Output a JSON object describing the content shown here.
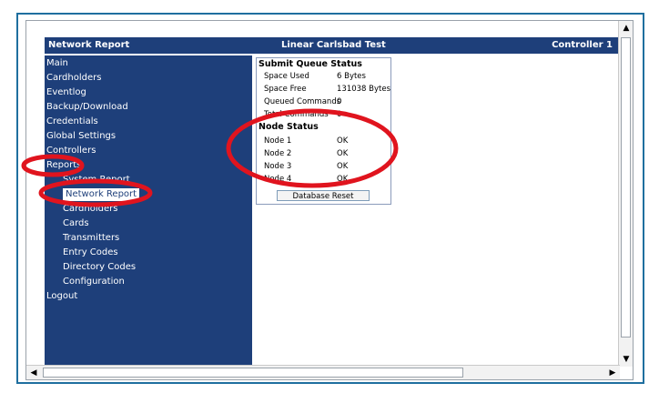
{
  "header": {
    "left": "Network Report",
    "center": "Linear Carlsbad Test",
    "right": "Controller 1"
  },
  "sidebar": {
    "items": [
      {
        "label": "Main"
      },
      {
        "label": "Cardholders"
      },
      {
        "label": "Eventlog"
      },
      {
        "label": "Backup/Download"
      },
      {
        "label": "Credentials"
      },
      {
        "label": "Global Settings"
      },
      {
        "label": "Controllers"
      },
      {
        "label": "Reports"
      },
      {
        "label": "System Report"
      },
      {
        "label": "Network Report"
      },
      {
        "label": "Cardholders"
      },
      {
        "label": "Cards"
      },
      {
        "label": "Transmitters"
      },
      {
        "label": "Entry Codes"
      },
      {
        "label": "Directory Codes"
      },
      {
        "label": "Configuration"
      },
      {
        "label": "Logout"
      }
    ]
  },
  "submit_queue": {
    "title": "Submit Queue Status",
    "rows": [
      {
        "label": "Space Used",
        "value": "6 Bytes"
      },
      {
        "label": "Space Free",
        "value": "131038 Bytes"
      },
      {
        "label": "Queued Commands",
        "value": "0"
      },
      {
        "label": "Total Commands",
        "value": "0"
      }
    ]
  },
  "node_status": {
    "title": "Node Status",
    "rows": [
      {
        "label": "Node 1",
        "value": "OK"
      },
      {
        "label": "Node 2",
        "value": "OK"
      },
      {
        "label": "Node 3",
        "value": "OK"
      },
      {
        "label": "Node 4",
        "value": "OK"
      }
    ]
  },
  "database_button": "Database Reset",
  "colors": {
    "nav_bg": "#1e3f7a",
    "frame_border": "#1f6f9f",
    "highlight_red": "#e0141e"
  },
  "icons": {
    "scroll_up": "triangle-up",
    "scroll_down": "triangle-down",
    "scroll_left": "triangle-left",
    "scroll_right": "triangle-right"
  }
}
